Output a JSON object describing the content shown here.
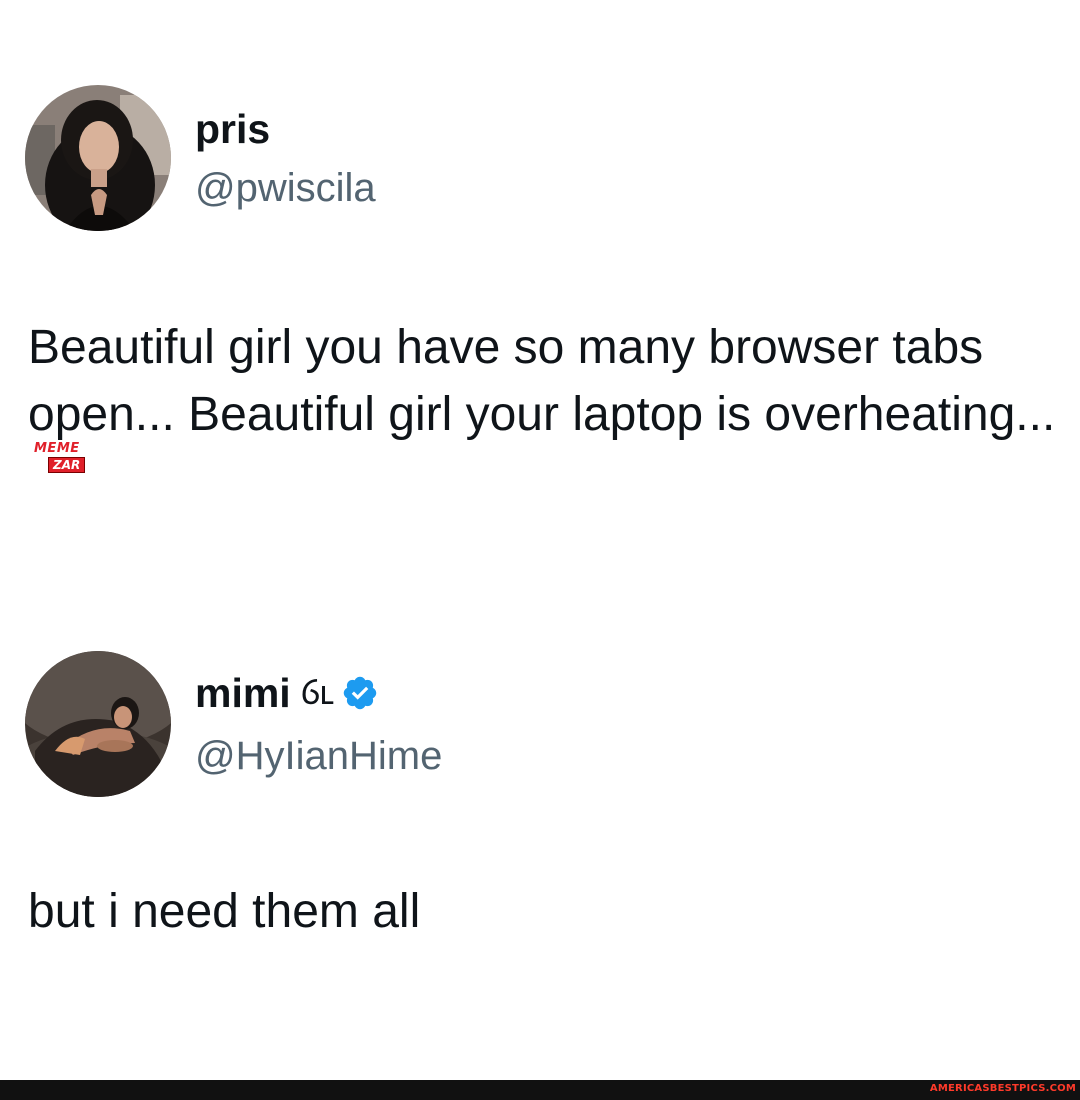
{
  "tweets": [
    {
      "display_name": "pris",
      "handle": "@pwiscila",
      "verified": false,
      "avatar": "profile-photo-woman-dark-hair",
      "text": "Beautiful girl you have so many browser tabs open... Beautiful girl your laptop is overheating..."
    },
    {
      "display_name": "mimi",
      "name_glyph": "ⳓⳑ",
      "handle": "@HyIianHime",
      "verified": true,
      "avatar": "profile-photo-woman-lying-in-cave",
      "text": "but i need them all"
    }
  ],
  "watermark": {
    "line1": "MEME",
    "line2": "ZAR"
  },
  "footer": {
    "credit": "AMERICASBESTPICS.COM"
  },
  "colors": {
    "text": "#0f1419",
    "handle": "#536471",
    "verified_badge": "#1d9bf0",
    "watermark_red": "#e0202a",
    "footer_bg": "#111111",
    "footer_text": "#ff3a2a"
  }
}
